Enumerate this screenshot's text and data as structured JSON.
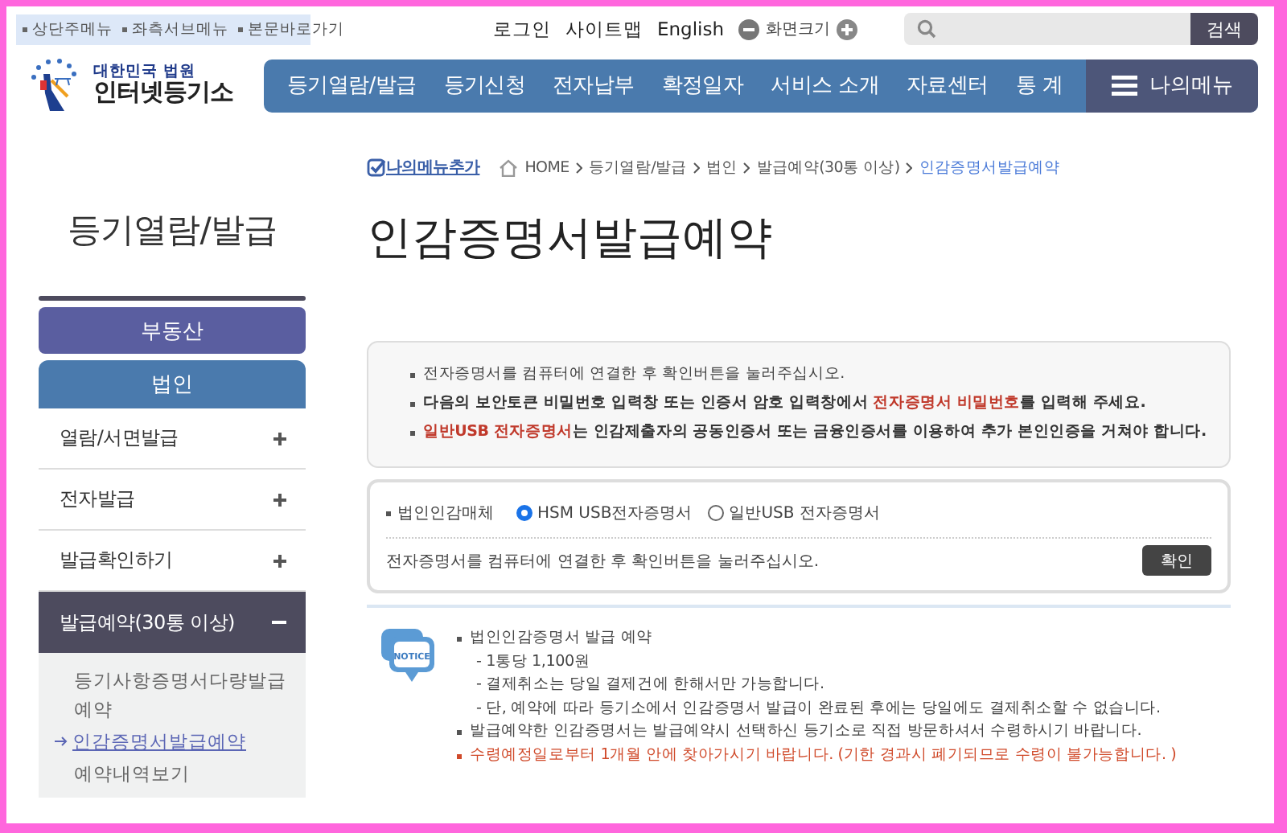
{
  "skip_links": [
    "상단주메뉴",
    "좌측서브메뉴",
    "본문바로가기"
  ],
  "utility_links": [
    "로그인",
    "사이트맵",
    "English"
  ],
  "zoom_control": {
    "label": "화면크기"
  },
  "search": {
    "button": "검색"
  },
  "logo": {
    "subtitle": "대한민국 법원",
    "title": "인터넷등기소"
  },
  "nav": {
    "items": [
      "등기열람/발급",
      "등기신청",
      "전자납부",
      "확정일자",
      "서비스 소개",
      "자료센터",
      "통 계"
    ],
    "my_menu": "나의메뉴"
  },
  "sidebar": {
    "title": "등기열람/발급",
    "categories": [
      {
        "label": "부동산",
        "selected": false
      },
      {
        "label": "법인",
        "selected": true
      }
    ],
    "items": [
      {
        "label": "열람/서면발급",
        "expanded": false
      },
      {
        "label": "전자발급",
        "expanded": false
      },
      {
        "label": "발급확인하기",
        "expanded": false
      },
      {
        "label": "발급예약(30통 이상)",
        "expanded": true,
        "children": [
          {
            "label": "등기사항증명서다량발급예약",
            "selected": false
          },
          {
            "label": "인감증명서발급예약",
            "selected": true
          },
          {
            "label": "예약내역보기",
            "selected": false
          }
        ]
      }
    ]
  },
  "breadcrumb": {
    "add_menu": "나의메뉴추가",
    "items": [
      {
        "label": "HOME",
        "current": false
      },
      {
        "label": "등기열람/발급",
        "current": false
      },
      {
        "label": "법인",
        "current": false
      },
      {
        "label": "발급예약(30통 이상)",
        "current": false
      },
      {
        "label": "인감증명서발급예약",
        "current": true
      }
    ]
  },
  "page_title": "인감증명서발급예약",
  "info": [
    {
      "bold": false,
      "segments": [
        {
          "text": "전자증명서를 컴퓨터에 연결한 후 확인버튼을 눌러주십시오.",
          "highlight": false
        }
      ]
    },
    {
      "bold": true,
      "segments": [
        {
          "text": "다음의 보안토큰 비밀번호 입력창 또는 인증서 암호 입력창에서 ",
          "highlight": false
        },
        {
          "text": "전자증명서 비밀번호",
          "highlight": true
        },
        {
          "text": "를 입력해 주세요.",
          "highlight": false
        }
      ]
    },
    {
      "bold": true,
      "segments": [
        {
          "text": "일반USB 전자증명서",
          "highlight": true
        },
        {
          "text": "는 인감제출자의 공동인증서 또는 금융인증서를 이용하여 추가 본인인증을 거쳐야 합니다.",
          "highlight": false
        }
      ]
    }
  ],
  "form": {
    "label": "법인인감매체",
    "options": [
      {
        "label": "HSM USB전자증명서",
        "selected": true
      },
      {
        "label": "일반USB 전자증명서",
        "selected": false
      }
    ],
    "hint": "전자증명서를 컴퓨터에 연결한 후 확인버튼을 눌러주십시오.",
    "button": "확인"
  },
  "notice": {
    "badge": "NOTICE",
    "items": [
      {
        "text": "법인인감증명서 발급 예약",
        "highlight": false,
        "children": [
          "- 1통당 1,100원",
          "- 결제취소는 당일 결제건에 한해서만 가능합니다.",
          "- 단, 예약에 따라 등기소에서 인감증명서 발급이 완료된 후에는 당일에도 결제취소할 수 없습니다."
        ]
      },
      {
        "text": "발급예약한 인감증명서는 발급예약시 선택하신 등기소로 직접 방문하셔서 수령하시기 바랍니다.",
        "highlight": false
      },
      {
        "text": "수령예정일로부터 1개월 안에 찾아가시기 바랍니다. (기한 경과시 폐기되므로 수령이 불가능합니다. )",
        "highlight": true
      }
    ]
  }
}
